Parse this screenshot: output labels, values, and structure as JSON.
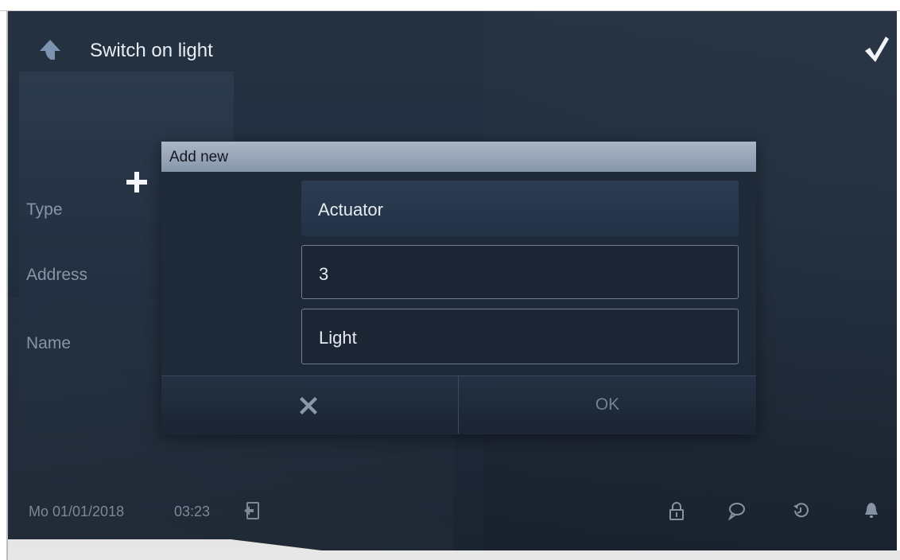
{
  "header": {
    "title": "Switch on light",
    "back_icon": "arrow-up-left-icon",
    "confirm_icon": "checkmark-icon"
  },
  "add_tile": {
    "icon": "plus-icon"
  },
  "dialog": {
    "title": "Add new",
    "fields": [
      {
        "label": "Type",
        "value": "Actuator"
      },
      {
        "label": "Address",
        "value": "3"
      },
      {
        "label": "Name",
        "value": "Light"
      }
    ],
    "cancel_icon": "close-icon",
    "ok_label": "OK"
  },
  "statusbar": {
    "date": "Mo 01/01/2018",
    "time": "03:23",
    "icons": [
      "logout-icon",
      "lock-icon",
      "message-icon",
      "history-icon",
      "bell-icon"
    ]
  },
  "colors": {
    "background": "#1f2a38",
    "dialog_header": "#9aa7b9",
    "text_primary": "#e8edf3",
    "text_muted": "#8796a7"
  }
}
